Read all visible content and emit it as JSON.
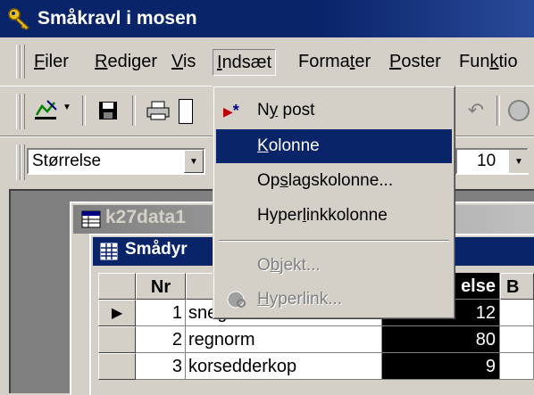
{
  "window": {
    "title": "Småkravl i mosen"
  },
  "menubar": {
    "items": [
      {
        "label": "Filer",
        "ul": "F",
        "rest": "iler"
      },
      {
        "label": "Rediger",
        "ul": "R",
        "rest": "ediger"
      },
      {
        "label": "Vis",
        "ul": "V",
        "rest": "is"
      },
      {
        "label": "Indsæt",
        "ul": "I",
        "rest": "ndsæt"
      },
      {
        "label": "Formater",
        "pre": "Forma",
        "ul": "t",
        "rest": "er"
      },
      {
        "label": "Poster",
        "ul": "P",
        "rest": "oster"
      },
      {
        "label": "Funktio",
        "pre": "Fun",
        "ul": "k",
        "rest": "tio"
      }
    ]
  },
  "formatbar": {
    "font_field": "Størrelse",
    "size_field": "10"
  },
  "db_window": {
    "title": "k27data1"
  },
  "table_window": {
    "title": "Smådyr",
    "columns": [
      "Nr",
      "",
      "else",
      "B"
    ],
    "rows": [
      {
        "nr": "1",
        "name": "snegl",
        "value": "12"
      },
      {
        "nr": "2",
        "name": "regnorm",
        "value": "80"
      },
      {
        "nr": "3",
        "name": "korsedderkop",
        "value": "9"
      }
    ]
  },
  "dropdown": {
    "items": [
      {
        "label": "Ny post",
        "pre": "N",
        "ul": "y",
        "rest": " post",
        "icon": "new-record-icon"
      },
      {
        "label": "Kolonne",
        "pre": "",
        "ul": "K",
        "rest": "olonne"
      },
      {
        "label": "Opslagskolonne...",
        "pre": "Op",
        "ul": "s",
        "rest": "lagskolonne..."
      },
      {
        "label": "Hyperlinkkolonne",
        "pre": "Hyper",
        "ul": "l",
        "rest": "inkkolonne"
      },
      {
        "label": "Objekt...",
        "pre": "O",
        "ul": "b",
        "rest": "jekt..."
      },
      {
        "label": "Hyperlink...",
        "pre": "",
        "ul": "H",
        "rest": "yperlink...",
        "icon": "hyperlink-icon"
      }
    ]
  },
  "colors": {
    "titlebar": "#0a246a",
    "highlight": "#0a246a",
    "chrome": "#d4d0c8"
  }
}
